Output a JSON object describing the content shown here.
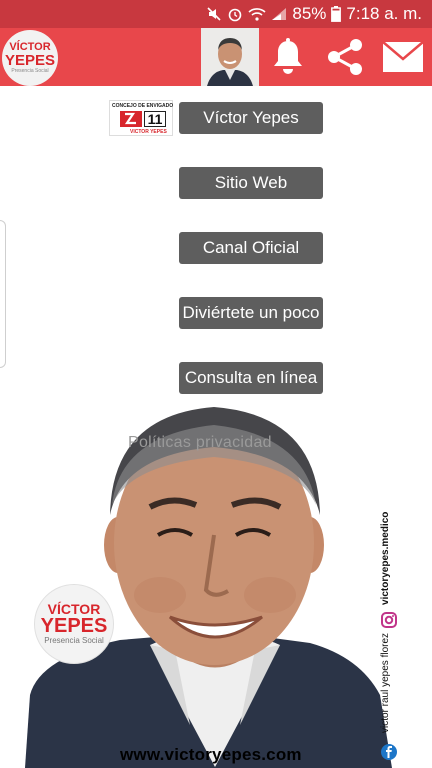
{
  "status_bar": {
    "battery": "85%",
    "time": "7:18 a. m."
  },
  "app_bar": {
    "logo_line1": "VÍCTOR",
    "logo_line2": "YEPES",
    "logo_line3": "Presencia Social",
    "icons": [
      "bell-icon",
      "share-icon",
      "mail-icon"
    ]
  },
  "badge": {
    "title": "CONCEJO DE ENVIGADO",
    "number": "11",
    "name": "VICTOR YEPES"
  },
  "menu": [
    {
      "label": "Víctor Yepes"
    },
    {
      "label": "Sitio Web"
    },
    {
      "label": "Canal Oficial"
    },
    {
      "label": "Diviértete un poco"
    },
    {
      "label": "Consulta en línea"
    }
  ],
  "privacy_link": "Políticas privacidad",
  "bottom_logo": {
    "line1": "VÍCTOR",
    "line2": "YEPES",
    "line3": "Presencia Social"
  },
  "social": {
    "instagram": "victoryepes.medico",
    "facebook": "victor raul yepes florez"
  },
  "footer_url": "www.victoryepes.com",
  "colors": {
    "status_bar": "#c8383f",
    "app_bar": "#e8474b",
    "button": "#5e5e5e",
    "brand_red": "#d8262c"
  }
}
